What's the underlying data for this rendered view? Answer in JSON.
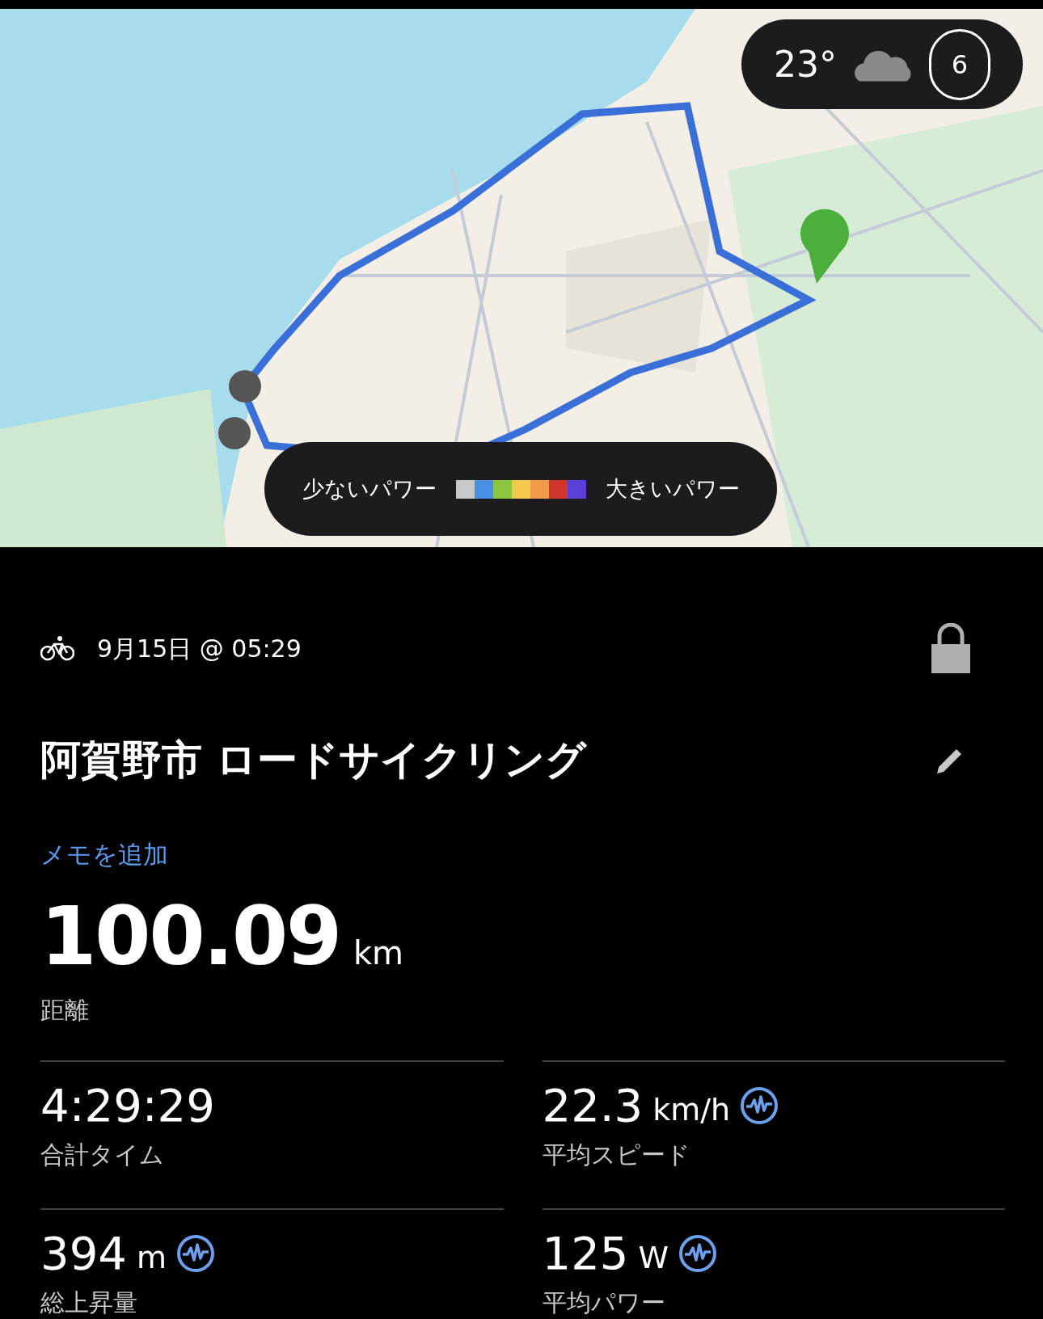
{
  "map": {
    "weather": {
      "temperature": "23°",
      "badge": "6"
    },
    "legend": {
      "low": "少ないパワー",
      "high": "大きいパワー",
      "swatches": [
        {
          "color": "#c8c8c8"
        },
        {
          "color": "#4a90e2"
        },
        {
          "color": "#8cc63f"
        },
        {
          "color": "#f2c94c"
        },
        {
          "color": "#f2994a"
        },
        {
          "color": "#d0352b"
        },
        {
          "color": "#5b3fd6"
        }
      ]
    }
  },
  "activity": {
    "date": "9月15日 @ 05:29",
    "locked": true,
    "title": "阿賀野市 ロードサイクリング",
    "memo_link": "メモを追加",
    "distance": {
      "value": "100.09",
      "unit": "km",
      "label": "距離"
    },
    "stats": [
      {
        "value": "4:29:29",
        "label": "合計タイム",
        "analysis": false
      },
      {
        "value": "22.3",
        "unit": "km/h",
        "label": "平均スピード",
        "analysis": true
      },
      {
        "value": "394",
        "unit": "m",
        "label": "総上昇量",
        "analysis": true
      },
      {
        "value": "125",
        "unit": "W",
        "label": "平均パワー",
        "analysis": true
      }
    ]
  }
}
